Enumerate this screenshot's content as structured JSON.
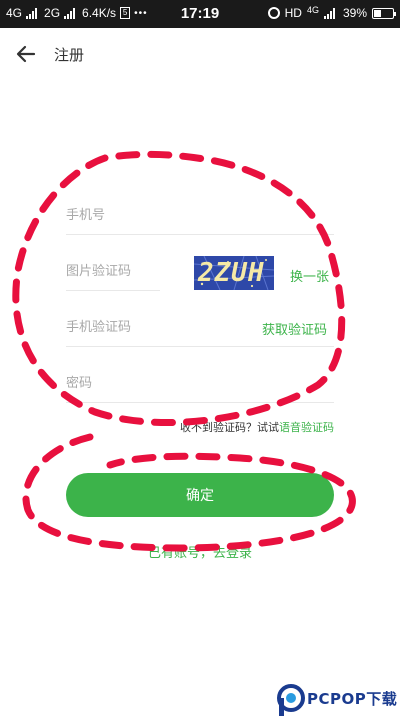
{
  "status_bar": {
    "net1": "4G",
    "net2": "2G",
    "speed": "6.4K/s",
    "sim_label": "5",
    "dots": "•••",
    "time": "17:19",
    "hd": "HD",
    "net3": "4G",
    "battery": "39%",
    "battery_level": 0.39
  },
  "app_bar": {
    "title": "注册"
  },
  "form": {
    "phone_placeholder": "手机号",
    "captcha_placeholder": "图片验证码",
    "captcha_text": "2ZUH",
    "refresh_captcha": "换一张",
    "sms_placeholder": "手机验证码",
    "get_sms_code": "获取验证码",
    "password_placeholder": "密码"
  },
  "hint": {
    "text": "收不到验证码？试试",
    "voice_link": "语音验证码"
  },
  "confirm_label": "确定",
  "login_link": "已有账号，去登录",
  "watermark": {
    "text": "PCPOP下载"
  },
  "colors": {
    "accent": "#3cb34a",
    "annotation": "#e8103e",
    "captcha_bg": "#2e48a8",
    "watermark": "#1a3b8f"
  },
  "icons": {
    "back": "arrow-left-icon",
    "alarm": "alarm-icon",
    "battery": "battery-icon"
  }
}
